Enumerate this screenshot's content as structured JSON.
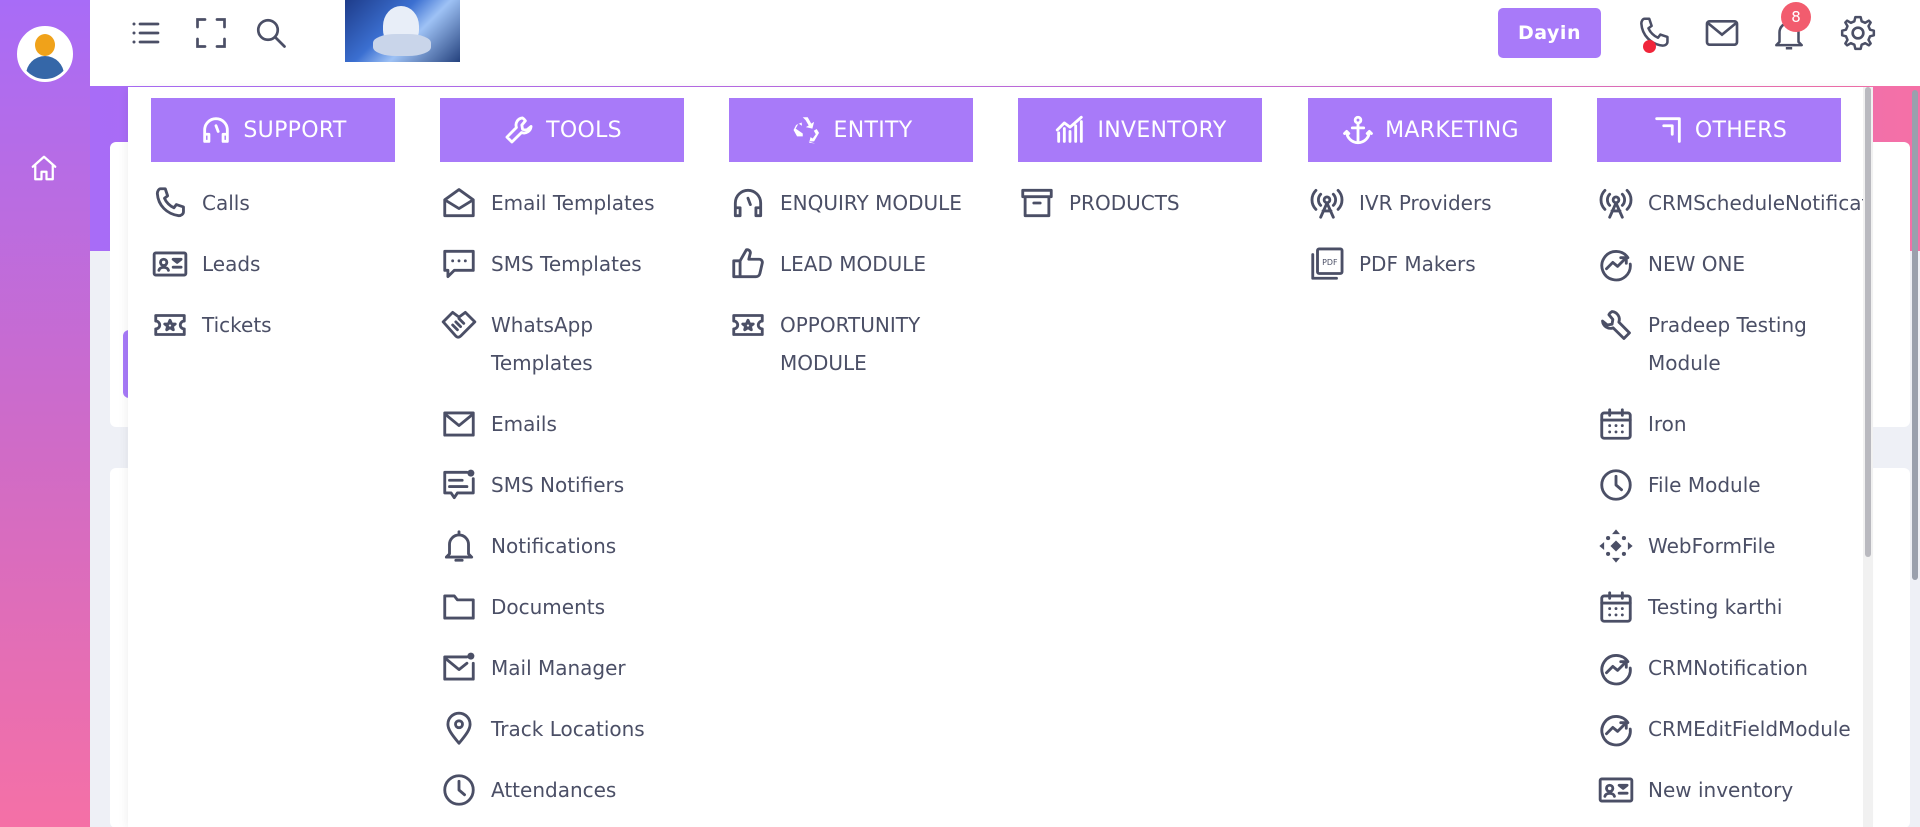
{
  "topbar": {
    "user_button_label": "Dayin",
    "notification_count": "8"
  },
  "menu": {
    "columns": [
      {
        "title": "SUPPORT",
        "icon": "headset-icon",
        "items": [
          {
            "label": "Calls",
            "icon": "phone-icon"
          },
          {
            "label": "Leads",
            "icon": "contact-card-icon"
          },
          {
            "label": "Tickets",
            "icon": "ticket-icon"
          }
        ]
      },
      {
        "title": "TOOLS",
        "icon": "wrench-icon",
        "items": [
          {
            "label": "Email Templates",
            "icon": "envelope-open-icon"
          },
          {
            "label": "SMS Templates",
            "icon": "chat-dots-icon"
          },
          {
            "label": "WhatsApp Templates",
            "icon": "handshake-icon"
          },
          {
            "label": "Emails",
            "icon": "envelope-icon"
          },
          {
            "label": "SMS Notifiers",
            "icon": "chat-notify-icon"
          },
          {
            "label": "Notifications",
            "icon": "bell-icon"
          },
          {
            "label": "Documents",
            "icon": "folder-icon"
          },
          {
            "label": "Mail Manager",
            "icon": "mail-notify-icon"
          },
          {
            "label": "Track Locations",
            "icon": "map-pin-icon"
          },
          {
            "label": "Attendances",
            "icon": "clock-icon"
          }
        ]
      },
      {
        "title": "ENTITY",
        "icon": "recycle-icon",
        "items": [
          {
            "label": "ENQUIRY MODULE",
            "icon": "headset-icon"
          },
          {
            "label": "LEAD MODULE",
            "icon": "thumbs-up-icon"
          },
          {
            "label": "OPPORTUNITY MODULE",
            "icon": "ticket-icon"
          }
        ]
      },
      {
        "title": "INVENTORY",
        "icon": "chart-bars-icon",
        "items": [
          {
            "label": "PRODUCTS",
            "icon": "archive-box-icon"
          }
        ]
      },
      {
        "title": "MARKETING",
        "icon": "anchor-icon",
        "items": [
          {
            "label": "IVR Providers",
            "icon": "broadcast-icon"
          },
          {
            "label": "PDF Makers",
            "icon": "pdf-icon"
          }
        ]
      },
      {
        "title": "OTHERS",
        "icon": "corner-icon",
        "items": [
          {
            "label": "CRMScheduleNotification",
            "icon": "broadcast-icon"
          },
          {
            "label": "NEW ONE",
            "icon": "trend-circle-icon"
          },
          {
            "label": "Pradeep Testing Module",
            "icon": "wrench-icon"
          },
          {
            "label": "Iron",
            "icon": "calendar-icon"
          },
          {
            "label": "File Module",
            "icon": "clock-icon"
          },
          {
            "label": "WebFormFile",
            "icon": "move-arrows-icon"
          },
          {
            "label": "Testing karthi",
            "icon": "calendar-icon"
          },
          {
            "label": "CRMNotification",
            "icon": "trend-circle-icon"
          },
          {
            "label": "CRMEditFieldModule",
            "icon": "trend-circle-icon"
          },
          {
            "label": "New inventory",
            "icon": "contact-card-icon"
          }
        ]
      }
    ]
  }
}
